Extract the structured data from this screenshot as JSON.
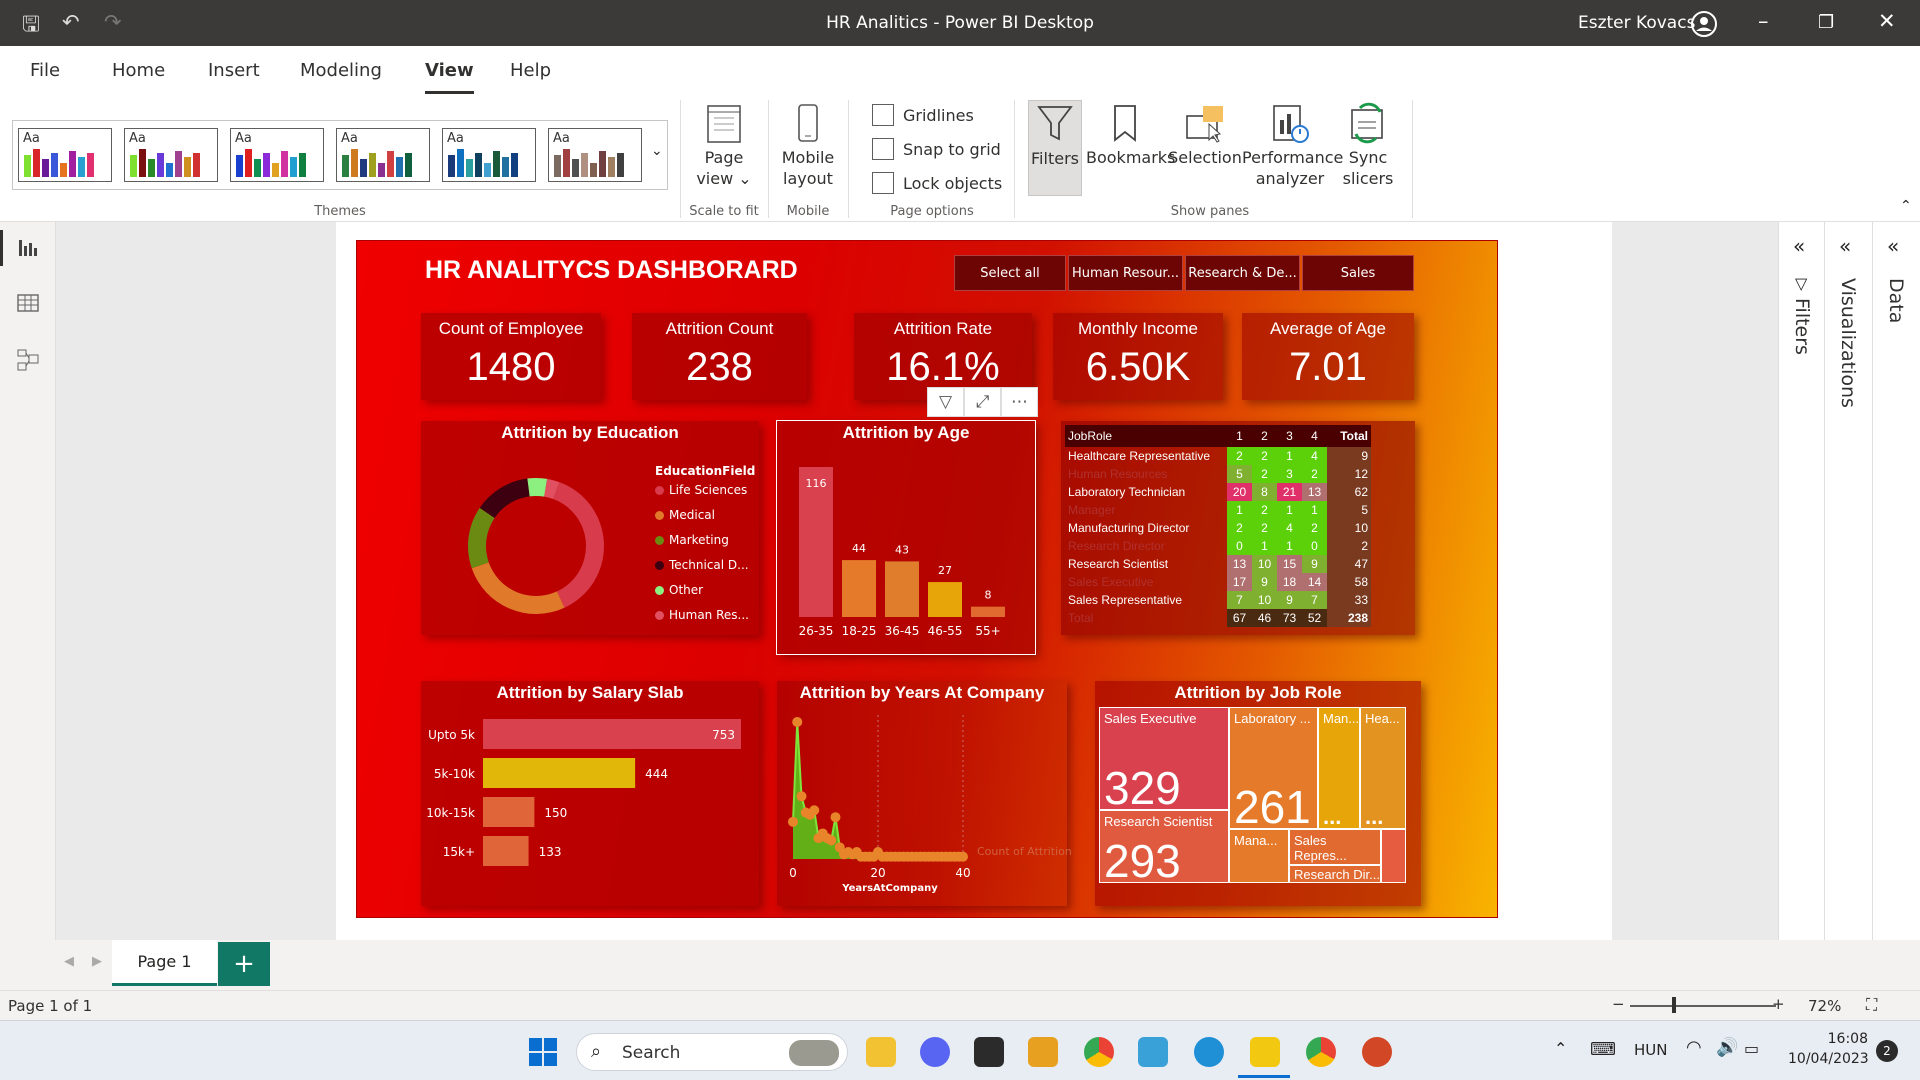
{
  "window": {
    "title": "HR Analitics - Power BI Desktop",
    "user": "Eszter Kovacs"
  },
  "menu": {
    "items": [
      "File",
      "Home",
      "Insert",
      "Modeling",
      "View",
      "Help"
    ],
    "active": "View"
  },
  "ribbon": {
    "theme_label": "Aa",
    "groups": {
      "themes": "Themes",
      "scale": "Scale to fit",
      "mobile": "Mobile",
      "page_options": "Page options",
      "show_panes": "Show panes"
    },
    "page_view": [
      "Page",
      "view"
    ],
    "mobile_layout": [
      "Mobile",
      "layout"
    ],
    "checkboxes": [
      "Gridlines",
      "Snap to grid",
      "Lock objects"
    ],
    "panes": {
      "filters": "Filters",
      "bookmarks": "Bookmarks",
      "selection": "Selection",
      "performance": [
        "Performance",
        "analyzer"
      ],
      "sync": [
        "Sync",
        "slicers"
      ]
    }
  },
  "dashboard": {
    "title": "HR ANALITYCS DASHBORARD",
    "slicers": [
      "Select all",
      "Human Resour...",
      "Research & De...",
      "Sales"
    ],
    "kpis": [
      {
        "label": "Count of Employee",
        "value": "1480"
      },
      {
        "label": "Attrition Count",
        "value": "238"
      },
      {
        "label": "Attrition Rate",
        "value": "16.1%"
      },
      {
        "label": "Monthly Income",
        "value": "6.50K"
      },
      {
        "label": "Average of Age",
        "value": "7.01"
      }
    ],
    "visual_titles": {
      "education": "Attrition by Education",
      "age": "Attrition by Age",
      "salary": "Attrition by Salary Slab",
      "years": "Attrition by Years At Company",
      "jobrole": "Attrition by Job Role"
    },
    "education_legend_title": "EducationField",
    "matrix": {
      "headers": [
        "JobRole",
        "1",
        "2",
        "3",
        "4",
        "Total"
      ],
      "rows": [
        {
          "role": "Healthcare Representative",
          "v": [
            "2",
            "2",
            "1",
            "4"
          ],
          "t": "9"
        },
        {
          "role": "Human Resources",
          "v": [
            "5",
            "2",
            "3",
            "2"
          ],
          "t": "12"
        },
        {
          "role": "Laboratory Technician",
          "v": [
            "20",
            "8",
            "21",
            "13"
          ],
          "t": "62"
        },
        {
          "role": "Manager",
          "v": [
            "1",
            "2",
            "1",
            "1"
          ],
          "t": "5"
        },
        {
          "role": "Manufacturing Director",
          "v": [
            "2",
            "2",
            "4",
            "2"
          ],
          "t": "10"
        },
        {
          "role": "Research Director",
          "v": [
            "0",
            "1",
            "1",
            "0"
          ],
          "t": "2"
        },
        {
          "role": "Research Scientist",
          "v": [
            "13",
            "10",
            "15",
            "9"
          ],
          "t": "47"
        },
        {
          "role": "Sales Executive",
          "v": [
            "17",
            "9",
            "18",
            "14"
          ],
          "t": "58"
        },
        {
          "role": "Sales Representative",
          "v": [
            "7",
            "10",
            "9",
            "7"
          ],
          "t": "33"
        },
        {
          "role": "Total",
          "v": [
            "67",
            "46",
            "73",
            "52"
          ],
          "t": "238"
        }
      ]
    },
    "treemap": {
      "sales_exec": "Sales Executive",
      "sales_exec_v": "329",
      "lab": "Laboratory ...",
      "lab_v": "261",
      "research_sci": "Research Scientist",
      "research_sci_v": "293",
      "man1": "Man...",
      "hea": "Hea...",
      "mana": "Mana...",
      "salesrep": "Sales Repres...",
      "resdir": "Research Dir...",
      "ellipsis": "..."
    }
  },
  "chart_data": [
    {
      "type": "pie",
      "title": "Attrition by Education",
      "legend_title": "EducationField",
      "labels": [
        "Life Sciences",
        "Medical",
        "Marketing",
        "Technical D...",
        "Other",
        "Human Res..."
      ],
      "values": [
        89,
        63,
        35,
        32,
        11,
        7
      ],
      "colors": [
        "#d83b4b",
        "#e07a2a",
        "#6a8a12",
        "#3d0010",
        "#8cf080",
        "#e05060"
      ]
    },
    {
      "type": "bar",
      "title": "Attrition by Age",
      "categories": [
        "26-35",
        "18-25",
        "36-45",
        "46-55",
        "55+"
      ],
      "values": [
        116,
        44,
        43,
        27,
        8
      ],
      "colors": [
        "#d8414d",
        "#e57b2a",
        "#e07d2c",
        "#e8a50a",
        "#e06a30"
      ]
    },
    {
      "type": "bar",
      "orientation": "horizontal",
      "title": "Attrition by Salary Slab",
      "categories": [
        "Upto 5k",
        "5k-10k",
        "10k-15k",
        "15k+"
      ],
      "values": [
        753,
        444,
        150,
        133
      ],
      "colors": [
        "#d8414d",
        "#e1b80a",
        "#e0663a",
        "#e0663a"
      ]
    },
    {
      "type": "area",
      "title": "Attrition by Years At Company",
      "xlabel": "YearsAtCompany",
      "ylabel": "Count of Attrition",
      "xticks": [
        "0",
        "20",
        "40"
      ],
      "x": [
        0,
        1,
        2,
        3,
        4,
        5,
        6,
        7,
        8,
        9,
        10,
        11,
        12,
        13,
        14,
        15,
        16,
        17,
        18,
        19,
        20,
        21,
        22,
        23,
        24,
        25,
        26,
        27,
        28,
        29,
        30,
        31,
        32,
        33,
        34,
        35,
        36,
        37,
        38,
        39,
        40
      ],
      "y": [
        16,
        59,
        27,
        20,
        19,
        21,
        9,
        11,
        9,
        8,
        18,
        5,
        2,
        3,
        2,
        3,
        1,
        1,
        1,
        1,
        3,
        1,
        1,
        1,
        1,
        1,
        1,
        1,
        1,
        1,
        1,
        1,
        1,
        1,
        1,
        1,
        1,
        1,
        1,
        1,
        1
      ]
    }
  ],
  "pages": {
    "tab": "Page 1",
    "add": "+",
    "status": "Page 1 of 1",
    "zoom": "72%"
  },
  "taskbar": {
    "search": "Search",
    "lang": "HUN",
    "time": "16:08",
    "date": "10/04/2023",
    "badge": "2"
  },
  "side_panes": {
    "filters": "Filters",
    "visualizations": "Visualizations",
    "data": "Data"
  }
}
